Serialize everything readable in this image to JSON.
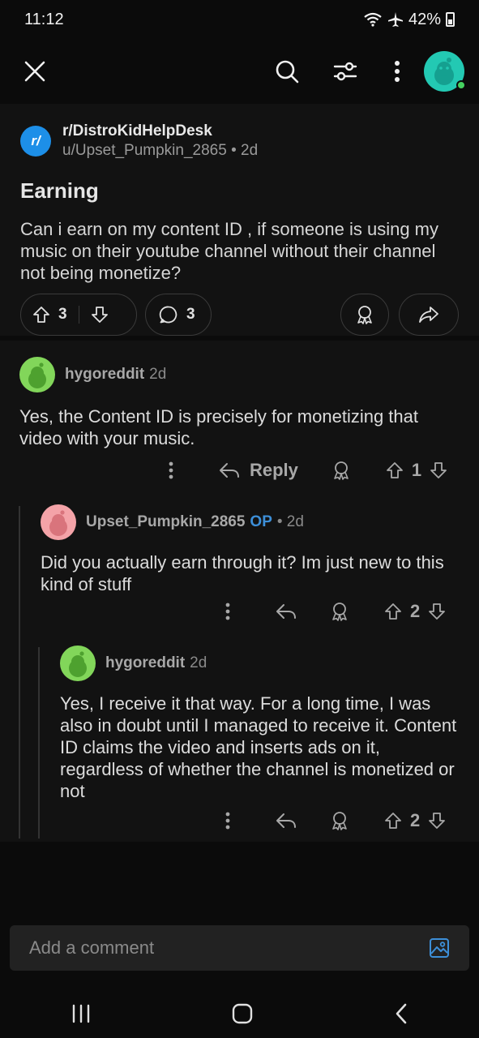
{
  "status": {
    "time": "11:12",
    "battery": "42%"
  },
  "post": {
    "subreddit": "r/DistroKidHelpDesk",
    "subreddit_icon": "r/",
    "author": "u/Upset_Pumpkin_2865",
    "age": "• 2d",
    "title": "Earning",
    "body": "Can i earn on my content ID , if someone is using my music on their youtube channel without their channel not being monetize?",
    "upvotes": "3",
    "comments": "3"
  },
  "comments": [
    {
      "user": "hygoreddit",
      "time": "2d",
      "text": "Yes, the Content ID is precisely for monetizing that video with your music.",
      "reply_label": "Reply",
      "score": "1"
    },
    {
      "user": "Upset_Pumpkin_2865",
      "op": "OP",
      "time": "• 2d",
      "text": "Did you actually earn through it? Im just new to this kind of stuff",
      "score": "2"
    },
    {
      "user": "hygoreddit",
      "time": "2d",
      "text": "Yes, I receive it that way. For a long time, I was also in doubt until I managed to receive it. Content ID claims the video and inserts ads on it, regardless of whether the channel is monetized or not",
      "score": "2"
    }
  ],
  "composer": {
    "placeholder": "Add a comment"
  },
  "colors": {
    "accent": "#3d8fd8",
    "subreddit_icon": "#1d8fe8",
    "avatar_top": "#23c9b3"
  }
}
